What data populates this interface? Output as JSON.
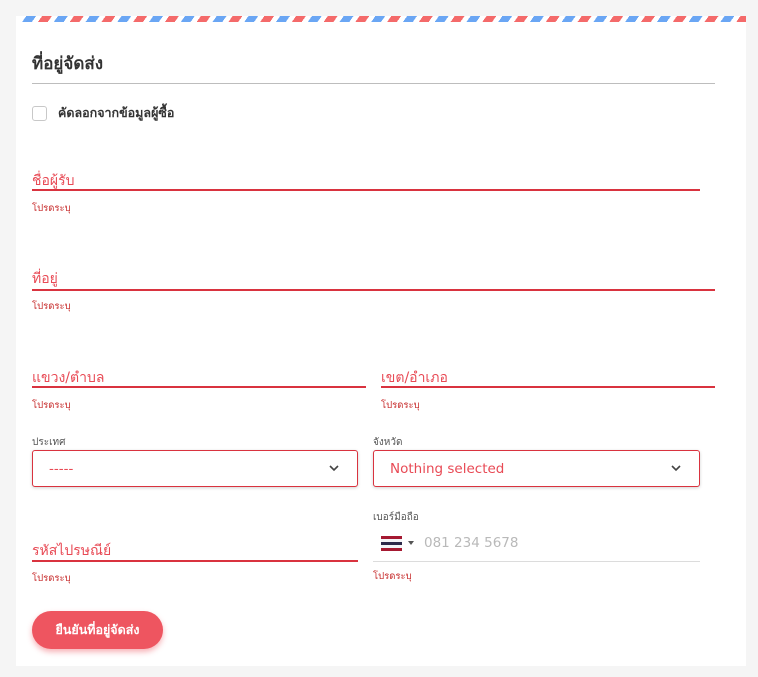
{
  "section_title": "ที่อยู่จัดส่ง",
  "copy_buyer": {
    "label": "คัดลอกจากข้อมูลผู้ซื้อ",
    "checked": false
  },
  "fields": {
    "recipient_name": {
      "label": "ชื่อผู้รับ",
      "error": "โปรดระบุ"
    },
    "address": {
      "label": "ที่อยู่",
      "error": "โปรดระบุ"
    },
    "subdistrict": {
      "label": "แขวง/ตำบล",
      "error": "โปรดระบุ"
    },
    "district": {
      "label": "เขต/อำเภอ",
      "error": "โปรดระบุ"
    },
    "postcode": {
      "label": "รหัสไปรษณีย์",
      "error": "โปรดระบุ"
    }
  },
  "country": {
    "label": "ประเทศ",
    "value": "-----"
  },
  "province": {
    "label": "จังหวัด",
    "value": "Nothing selected"
  },
  "mobile": {
    "label": "เบอร์มือถือ",
    "placeholder": "081 234 5678",
    "error": "โปรดระบุ",
    "flag_icon": "thailand-flag-icon"
  },
  "confirm_button": "ยืนยันที่อยู่จัดส่ง",
  "colors": {
    "accent": "#ee5560",
    "error": "#d9333f",
    "airmail_red": "#f46a6a",
    "airmail_blue": "#6aa6f4"
  }
}
